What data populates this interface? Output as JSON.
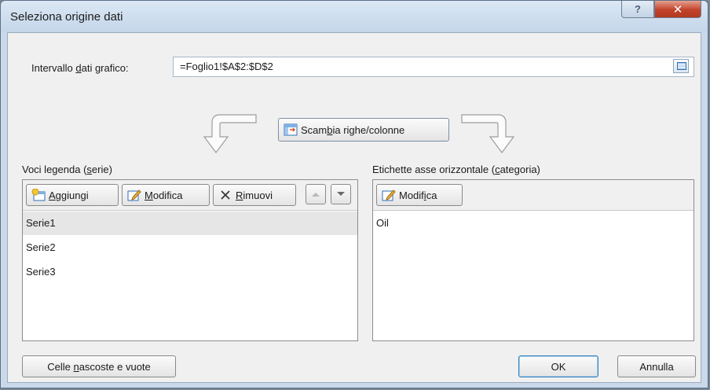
{
  "window": {
    "title": "Seleziona origine dati",
    "help_label": "?",
    "close_label": "✕"
  },
  "range": {
    "label_pre": "Intervallo ",
    "label_accel": "d",
    "label_post": "ati grafico:",
    "value": "=Foglio1!$A$2:$D$2",
    "collapse_icon": "range-collapse-icon"
  },
  "switch_button": {
    "label_pre": "Scam",
    "label_accel": "b",
    "label_post": "ia righe/colonne",
    "icon": "switch-rows-columns-icon"
  },
  "legend_section": {
    "label_pre": "Voci legenda (",
    "label_accel": "s",
    "label_post": "erie)",
    "add_label_accel": "A",
    "add_label_post": "ggiungi",
    "edit_label_pre": "",
    "edit_label_accel": "M",
    "edit_label_post": "odifica",
    "remove_label_accel": "R",
    "remove_label_post": "imuovi",
    "items": [
      {
        "label": "Serie1",
        "selected": true
      },
      {
        "label": "Serie2",
        "selected": false
      },
      {
        "label": "Serie3",
        "selected": false
      }
    ]
  },
  "category_section": {
    "label_pre": "Etichette asse orizzontale (",
    "label_accel": "c",
    "label_post": "ategoria)",
    "edit_label_pre": "Modif",
    "edit_label_accel": "i",
    "edit_label_post": "ca",
    "items": [
      {
        "label": "Oil"
      }
    ]
  },
  "footer": {
    "hidden_cells_pre": "Celle ",
    "hidden_cells_accel": "n",
    "hidden_cells_post": "ascoste e vuote",
    "ok_label": "OK",
    "cancel_label": "Annulla"
  },
  "colors": {
    "frame": "#c9d9ea",
    "close_button": "#c2432b",
    "selection": "#e6e6e6"
  }
}
